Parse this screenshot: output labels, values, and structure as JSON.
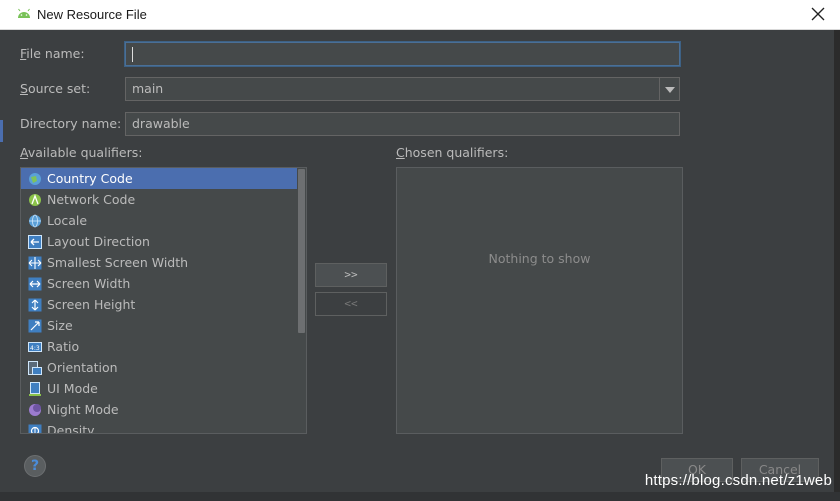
{
  "window": {
    "title": "New Resource File"
  },
  "form": {
    "file_name": {
      "label_first": "F",
      "label_rest": "ile name:",
      "value": ""
    },
    "source_set": {
      "label_first": "S",
      "label_rest": "ource set:",
      "value": "main"
    },
    "directory_name": {
      "label": "Directory name:",
      "value": "drawable"
    }
  },
  "qualifiers": {
    "available_label_first": "A",
    "available_label_rest": "vailable qualifiers:",
    "chosen_label_first": "C",
    "chosen_label_rest": "hosen qualifiers:",
    "items": [
      {
        "label": "Country Code",
        "icon": "globe-flag-icon",
        "selected": true
      },
      {
        "label": "Network Code",
        "icon": "network-icon"
      },
      {
        "label": "Locale",
        "icon": "globe-icon"
      },
      {
        "label": "Layout Direction",
        "icon": "layout-direction-icon"
      },
      {
        "label": "Smallest Screen Width",
        "icon": "smallest-width-icon"
      },
      {
        "label": "Screen Width",
        "icon": "screen-width-icon"
      },
      {
        "label": "Screen Height",
        "icon": "screen-height-icon"
      },
      {
        "label": "Size",
        "icon": "size-icon"
      },
      {
        "label": "Ratio",
        "icon": "ratio-icon"
      },
      {
        "label": "Orientation",
        "icon": "orientation-icon"
      },
      {
        "label": "UI Mode",
        "icon": "ui-mode-icon"
      },
      {
        "label": "Night Mode",
        "icon": "night-mode-icon"
      },
      {
        "label": "Density",
        "icon": "density-icon"
      }
    ],
    "add_button": ">>",
    "remove_button": "<<",
    "empty_text": "Nothing to show"
  },
  "footer": {
    "ok": "OK",
    "cancel": "Cancel"
  },
  "watermark": "https://blog.csdn.net/z1web",
  "colors": {
    "accent": "#4b6eaf",
    "background": "#3c3f41",
    "field": "#45494a"
  }
}
